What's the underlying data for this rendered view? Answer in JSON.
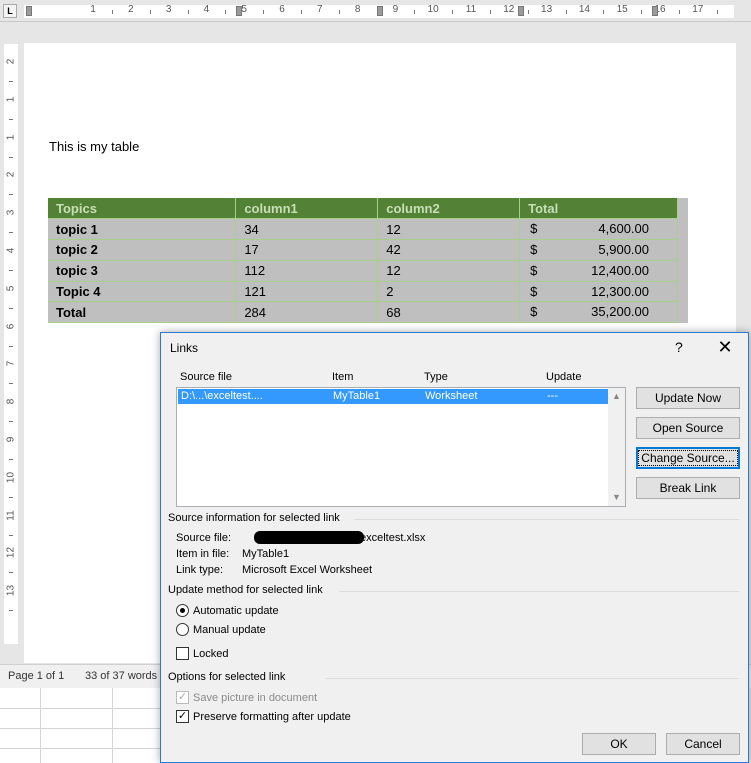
{
  "ruler": {
    "corner_glyph": "L",
    "h_numbers": [
      "1",
      "2",
      "3",
      "4",
      "5",
      "6",
      "7",
      "8",
      "9",
      "10",
      "11",
      "12",
      "13",
      "14",
      "15",
      "16",
      "17"
    ],
    "v_numbers": [
      "2",
      "1",
      "1",
      "2",
      "3",
      "4",
      "5",
      "6",
      "7",
      "8",
      "9",
      "10",
      "11",
      "12",
      "13"
    ]
  },
  "document": {
    "text": "This is my table",
    "table": {
      "headers": [
        "Topics",
        "column1",
        "column2",
        "Total"
      ],
      "rows": [
        {
          "topic": "topic 1",
          "c1": "34",
          "c2": "12",
          "cur": "$",
          "total": "4,600.00"
        },
        {
          "topic": "topic 2",
          "c1": "17",
          "c2": "42",
          "cur": "$",
          "total": "5,900.00"
        },
        {
          "topic": "topic 3",
          "c1": "112",
          "c2": "12",
          "cur": "$",
          "total": "12,400.00"
        },
        {
          "topic": "Topic 4",
          "c1": "121",
          "c2": "2",
          "cur": "$",
          "total": "12,300.00"
        },
        {
          "topic": "Total",
          "c1": "284",
          "c2": "68",
          "cur": "$",
          "total": "35,200.00"
        }
      ]
    }
  },
  "status": {
    "page": "Page 1 of 1",
    "words": "33 of 37 words"
  },
  "dialog": {
    "title": "Links",
    "help": "?",
    "close": "✕",
    "columns": {
      "source": "Source file",
      "item": "Item",
      "type": "Type",
      "update": "Update"
    },
    "selected_link": {
      "source": "D:\\...\\exceltest....",
      "item": "MyTable1",
      "type": "Worksheet",
      "update": "---"
    },
    "buttons": {
      "update_now": "Update Now",
      "open_source": "Open Source",
      "change_source": "Change Source...",
      "break_link": "Break Link",
      "ok": "OK",
      "cancel": "Cancel"
    },
    "source_info": {
      "heading": "Source information for selected link",
      "source_file_label": "Source file:",
      "source_file_value": "exceltest.xlsx",
      "item_label": "Item in file:",
      "item_value": "MyTable1",
      "link_type_label": "Link type:",
      "link_type_value": "Microsoft Excel Worksheet"
    },
    "update_method": {
      "heading": "Update method for selected link",
      "automatic": "Automatic update",
      "manual": "Manual update",
      "locked": "Locked",
      "selected": "automatic"
    },
    "options": {
      "heading": "Options for selected link",
      "save_picture": "Save picture in document",
      "preserve_formatting": "Preserve formatting after update",
      "save_picture_checked": true,
      "preserve_formatting_checked": true
    }
  },
  "colors": {
    "table_header": "#538135",
    "table_header_text": "#c6dfb7",
    "selection_gray": "#bfbfbf",
    "list_selection": "#3399ff",
    "dialog_border": "#2b79d0"
  }
}
